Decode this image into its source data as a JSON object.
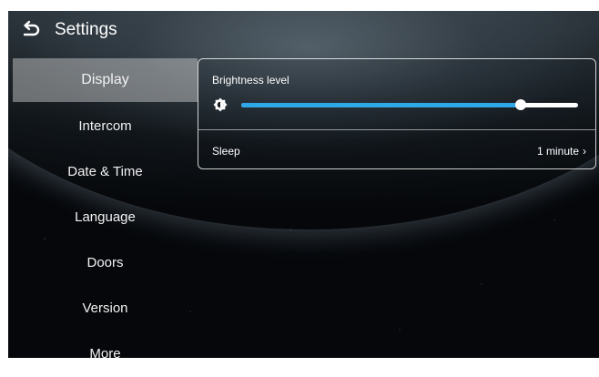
{
  "header": {
    "title": "Settings",
    "back_icon": "back-arrow-icon"
  },
  "sidebar": {
    "items": [
      {
        "label": "Display",
        "active": true
      },
      {
        "label": "Intercom"
      },
      {
        "label": "Date & Time"
      },
      {
        "label": "Language"
      },
      {
        "label": "Doors"
      },
      {
        "label": "Version"
      },
      {
        "label": "More"
      }
    ]
  },
  "display": {
    "brightness": {
      "label": "Brightness level",
      "icon": "brightness-icon",
      "value_fraction": 0.83,
      "accent": "#2fa8e8"
    },
    "sleep": {
      "label": "Sleep",
      "value": "1 minute",
      "chevron": "chevron-right-icon"
    }
  }
}
